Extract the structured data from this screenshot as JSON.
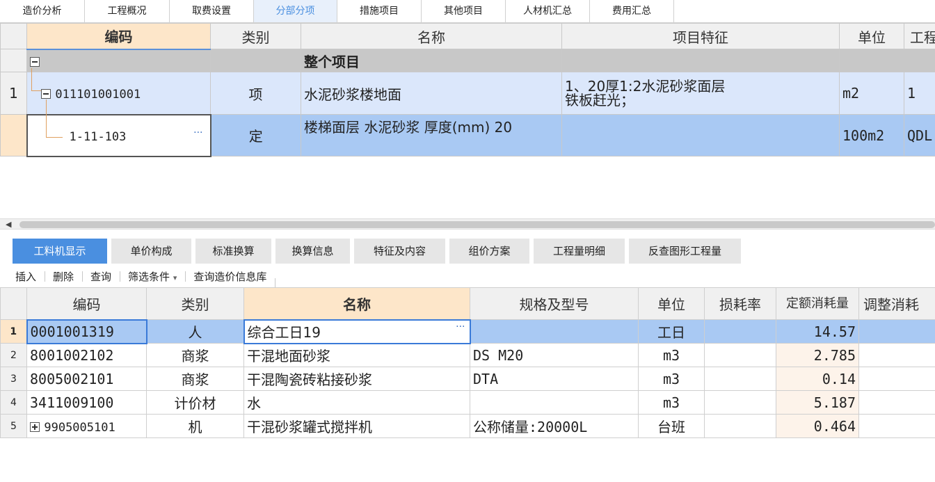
{
  "top_tabs": [
    "造价分析",
    "工程概况",
    "取费设置",
    "分部分项",
    "措施项目",
    "其他项目",
    "人材机汇总",
    "费用汇总"
  ],
  "top_tab_active": "分部分项",
  "upper_grid": {
    "headers": {
      "code": "编码",
      "category": "类别",
      "name": "名称",
      "feature": "项目特征",
      "unit": "单位",
      "qty": "工程"
    },
    "total_row": {
      "name": "整个项目"
    },
    "row1": {
      "num": "1",
      "code": "011101001001",
      "category": "项",
      "name": "水泥砂浆楼地面",
      "feature_line1": "1、20厚1:2水泥砂浆面层",
      "feature_line2": "铁板赶光；",
      "unit": "m2",
      "qty": "1"
    },
    "row2": {
      "code": "1-11-103",
      "ellipsis": "···",
      "category": "定",
      "name": "楼梯面层 水泥砂浆 厚度(mm) 20",
      "unit": "100m2",
      "qty": "QDL"
    }
  },
  "bottom_tabs": [
    "工料机显示",
    "单价构成",
    "标准换算",
    "换算信息",
    "特征及内容",
    "组价方案",
    "工程量明细",
    "反查图形工程量"
  ],
  "bottom_tab_active": "工料机显示",
  "toolbar": {
    "insert": "插入",
    "delete": "删除",
    "query": "查询",
    "filter": "筛选条件",
    "filter_arrow": "▾",
    "price_db": "查询造价信息库"
  },
  "lower_grid": {
    "headers": {
      "code": "编码",
      "category": "类别",
      "name": "名称",
      "spec": "规格及型号",
      "unit": "单位",
      "loss": "损耗率",
      "quota": "定额消耗量",
      "adjust": "调整消耗"
    },
    "rows": [
      {
        "num": "1",
        "code": "0001001319",
        "category": "人",
        "name": "综合工日19",
        "spec": "",
        "unit": "工日",
        "loss": "",
        "quota": "14.57"
      },
      {
        "num": "2",
        "code": "8001002102",
        "category": "商浆",
        "name": "干混地面砂浆",
        "spec": "DS M20",
        "unit": "m3",
        "loss": "",
        "quota": "2.785"
      },
      {
        "num": "3",
        "code": "8005002101",
        "category": "商浆",
        "name": "干混陶瓷砖粘接砂浆",
        "spec": "DTA",
        "unit": "m3",
        "loss": "",
        "quota": "0.14"
      },
      {
        "num": "4",
        "code": "3411009100",
        "category": "计价材",
        "name": "水",
        "spec": "",
        "unit": "m3",
        "loss": "",
        "quota": "5.187"
      },
      {
        "num": "5",
        "code": "9905005101",
        "category": "机",
        "name": "干混砂浆罐式搅拌机",
        "spec": "公称储量:20000L",
        "unit": "台班",
        "loss": "",
        "quota": "0.464"
      }
    ],
    "ellipsis": "···"
  },
  "colors": {
    "accent": "#4a8fe0",
    "selected_row": "#a9c9f3",
    "header_selected": "#fde6c9"
  }
}
